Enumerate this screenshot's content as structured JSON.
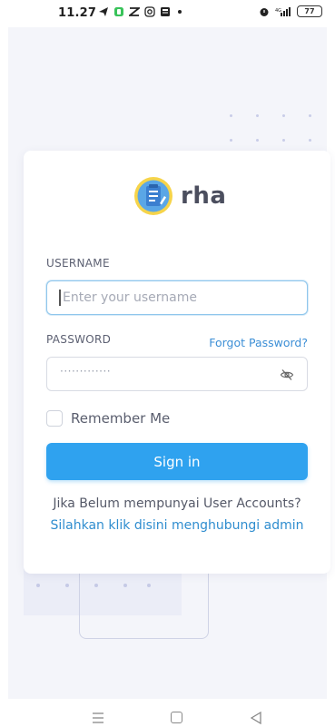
{
  "status_bar": {
    "time": "11.27",
    "left_icons": [
      "telegram-icon",
      "app-icon",
      "grid-app-icon",
      "instagram-icon",
      "news-icon"
    ],
    "right_icons": [
      "alarm-icon",
      "signal-icon"
    ],
    "battery": "77"
  },
  "app": {
    "brand_name": "rha",
    "logo_icon": "clipboard-logo-icon"
  },
  "form": {
    "username_label": "USERNAME",
    "username_placeholder": "Enter your  username",
    "password_label": "PASSWORD",
    "forgot_password": "Forgot Password?",
    "password_value": "·············",
    "remember_me": "Remember Me",
    "sign_in": "Sign in"
  },
  "footer_note": {
    "line1": "Jika Belum mempunyai User Accounts?",
    "line2": "Silahkan klik disini menghubungi admin"
  },
  "colors": {
    "primary": "#2fa2ef",
    "link": "#3d8fd6",
    "page_bg": "#f4f5fa"
  },
  "navigation_bar": {
    "icons": [
      "menu-icon",
      "home-icon",
      "back-icon"
    ]
  }
}
